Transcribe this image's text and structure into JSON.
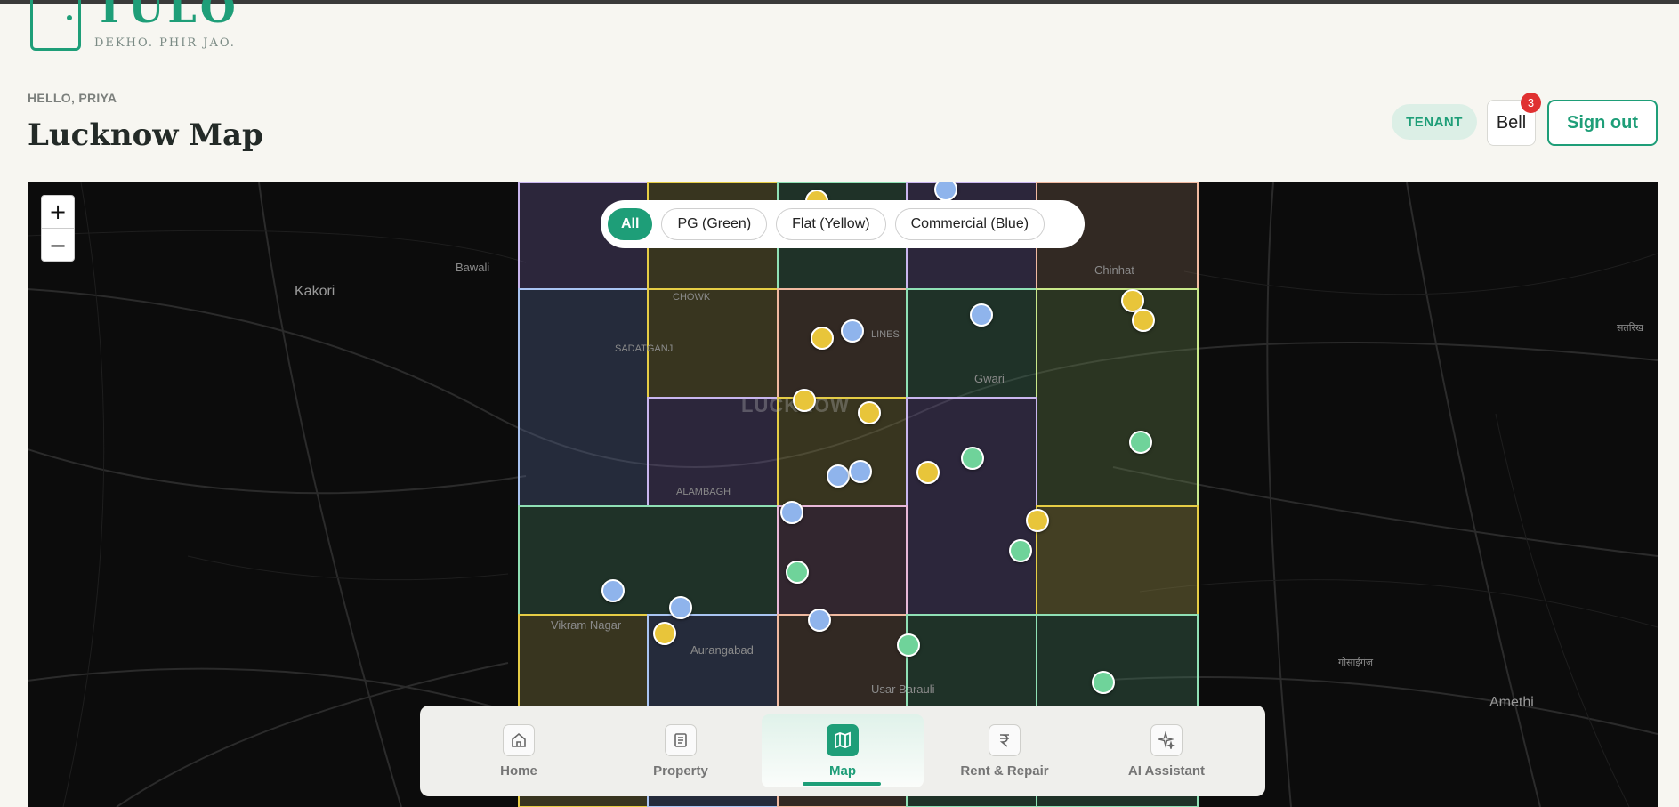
{
  "brand": {
    "name": "TULO",
    "tagline": "DEKHO. PHIR JAO."
  },
  "header": {
    "greeting": "HELLO, PRIYA",
    "title": "Lucknow Map",
    "role": "TENANT",
    "bell_label": "Bell",
    "bell_count": "3",
    "signout_label": "Sign out"
  },
  "map": {
    "zoom_in": "+",
    "zoom_out": "−",
    "filters": [
      {
        "label": "All",
        "active": true
      },
      {
        "label": "PG (Green)"
      },
      {
        "label": "Flat (Yellow)"
      },
      {
        "label": "Commercial (Blue)"
      }
    ],
    "labels": {
      "kakori": "Kakori",
      "bawali": "Bawali",
      "chinhat": "Chinhat",
      "chowk": "CHOWK",
      "sadatganj": "SADATGANJ",
      "lines": "LINES",
      "gwari": "Gwari",
      "lucknow": "LUCKNOW",
      "alambagh": "ALAMBAGH",
      "vikram_nagar": "Vikram Nagar",
      "aurangabad": "Aurangabad",
      "usar_barauli": "Usar Barauli",
      "amethi": "Amethi",
      "gosainganj": "गोसाईंगंज",
      "satrikh": "सतरिख"
    },
    "colors": {
      "pg": "#6fd39a",
      "flat": "#e8c53a",
      "commercial": "#8fb4ec"
    }
  },
  "nav": {
    "items": [
      {
        "label": "Home",
        "icon": "home-icon"
      },
      {
        "label": "Property",
        "icon": "document-icon"
      },
      {
        "label": "Map",
        "icon": "map-icon",
        "active": true
      },
      {
        "label": "Rent & Repair",
        "icon": "rupee-icon"
      },
      {
        "label": "AI Assistant",
        "icon": "sparkle-icon"
      }
    ]
  }
}
